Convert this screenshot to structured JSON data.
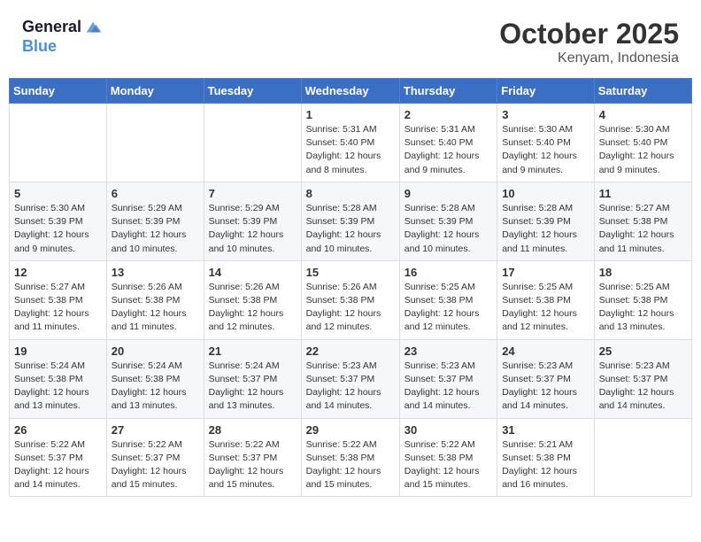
{
  "header": {
    "logo_line1": "General",
    "logo_line2": "Blue",
    "month": "October 2025",
    "location": "Kenyam, Indonesia"
  },
  "weekdays": [
    "Sunday",
    "Monday",
    "Tuesday",
    "Wednesday",
    "Thursday",
    "Friday",
    "Saturday"
  ],
  "weeks": [
    [
      {
        "day": "",
        "info": ""
      },
      {
        "day": "",
        "info": ""
      },
      {
        "day": "",
        "info": ""
      },
      {
        "day": "1",
        "info": "Sunrise: 5:31 AM\nSunset: 5:40 PM\nDaylight: 12 hours\nand 8 minutes."
      },
      {
        "day": "2",
        "info": "Sunrise: 5:31 AM\nSunset: 5:40 PM\nDaylight: 12 hours\nand 9 minutes."
      },
      {
        "day": "3",
        "info": "Sunrise: 5:30 AM\nSunset: 5:40 PM\nDaylight: 12 hours\nand 9 minutes."
      },
      {
        "day": "4",
        "info": "Sunrise: 5:30 AM\nSunset: 5:40 PM\nDaylight: 12 hours\nand 9 minutes."
      }
    ],
    [
      {
        "day": "5",
        "info": "Sunrise: 5:30 AM\nSunset: 5:39 PM\nDaylight: 12 hours\nand 9 minutes."
      },
      {
        "day": "6",
        "info": "Sunrise: 5:29 AM\nSunset: 5:39 PM\nDaylight: 12 hours\nand 10 minutes."
      },
      {
        "day": "7",
        "info": "Sunrise: 5:29 AM\nSunset: 5:39 PM\nDaylight: 12 hours\nand 10 minutes."
      },
      {
        "day": "8",
        "info": "Sunrise: 5:28 AM\nSunset: 5:39 PM\nDaylight: 12 hours\nand 10 minutes."
      },
      {
        "day": "9",
        "info": "Sunrise: 5:28 AM\nSunset: 5:39 PM\nDaylight: 12 hours\nand 10 minutes."
      },
      {
        "day": "10",
        "info": "Sunrise: 5:28 AM\nSunset: 5:39 PM\nDaylight: 12 hours\nand 11 minutes."
      },
      {
        "day": "11",
        "info": "Sunrise: 5:27 AM\nSunset: 5:38 PM\nDaylight: 12 hours\nand 11 minutes."
      }
    ],
    [
      {
        "day": "12",
        "info": "Sunrise: 5:27 AM\nSunset: 5:38 PM\nDaylight: 12 hours\nand 11 minutes."
      },
      {
        "day": "13",
        "info": "Sunrise: 5:26 AM\nSunset: 5:38 PM\nDaylight: 12 hours\nand 11 minutes."
      },
      {
        "day": "14",
        "info": "Sunrise: 5:26 AM\nSunset: 5:38 PM\nDaylight: 12 hours\nand 12 minutes."
      },
      {
        "day": "15",
        "info": "Sunrise: 5:26 AM\nSunset: 5:38 PM\nDaylight: 12 hours\nand 12 minutes."
      },
      {
        "day": "16",
        "info": "Sunrise: 5:25 AM\nSunset: 5:38 PM\nDaylight: 12 hours\nand 12 minutes."
      },
      {
        "day": "17",
        "info": "Sunrise: 5:25 AM\nSunset: 5:38 PM\nDaylight: 12 hours\nand 12 minutes."
      },
      {
        "day": "18",
        "info": "Sunrise: 5:25 AM\nSunset: 5:38 PM\nDaylight: 12 hours\nand 13 minutes."
      }
    ],
    [
      {
        "day": "19",
        "info": "Sunrise: 5:24 AM\nSunset: 5:38 PM\nDaylight: 12 hours\nand 13 minutes."
      },
      {
        "day": "20",
        "info": "Sunrise: 5:24 AM\nSunset: 5:38 PM\nDaylight: 12 hours\nand 13 minutes."
      },
      {
        "day": "21",
        "info": "Sunrise: 5:24 AM\nSunset: 5:37 PM\nDaylight: 12 hours\nand 13 minutes."
      },
      {
        "day": "22",
        "info": "Sunrise: 5:23 AM\nSunset: 5:37 PM\nDaylight: 12 hours\nand 14 minutes."
      },
      {
        "day": "23",
        "info": "Sunrise: 5:23 AM\nSunset: 5:37 PM\nDaylight: 12 hours\nand 14 minutes."
      },
      {
        "day": "24",
        "info": "Sunrise: 5:23 AM\nSunset: 5:37 PM\nDaylight: 12 hours\nand 14 minutes."
      },
      {
        "day": "25",
        "info": "Sunrise: 5:23 AM\nSunset: 5:37 PM\nDaylight: 12 hours\nand 14 minutes."
      }
    ],
    [
      {
        "day": "26",
        "info": "Sunrise: 5:22 AM\nSunset: 5:37 PM\nDaylight: 12 hours\nand 14 minutes."
      },
      {
        "day": "27",
        "info": "Sunrise: 5:22 AM\nSunset: 5:37 PM\nDaylight: 12 hours\nand 15 minutes."
      },
      {
        "day": "28",
        "info": "Sunrise: 5:22 AM\nSunset: 5:37 PM\nDaylight: 12 hours\nand 15 minutes."
      },
      {
        "day": "29",
        "info": "Sunrise: 5:22 AM\nSunset: 5:38 PM\nDaylight: 12 hours\nand 15 minutes."
      },
      {
        "day": "30",
        "info": "Sunrise: 5:22 AM\nSunset: 5:38 PM\nDaylight: 12 hours\nand 15 minutes."
      },
      {
        "day": "31",
        "info": "Sunrise: 5:21 AM\nSunset: 5:38 PM\nDaylight: 12 hours\nand 16 minutes."
      },
      {
        "day": "",
        "info": ""
      }
    ]
  ]
}
